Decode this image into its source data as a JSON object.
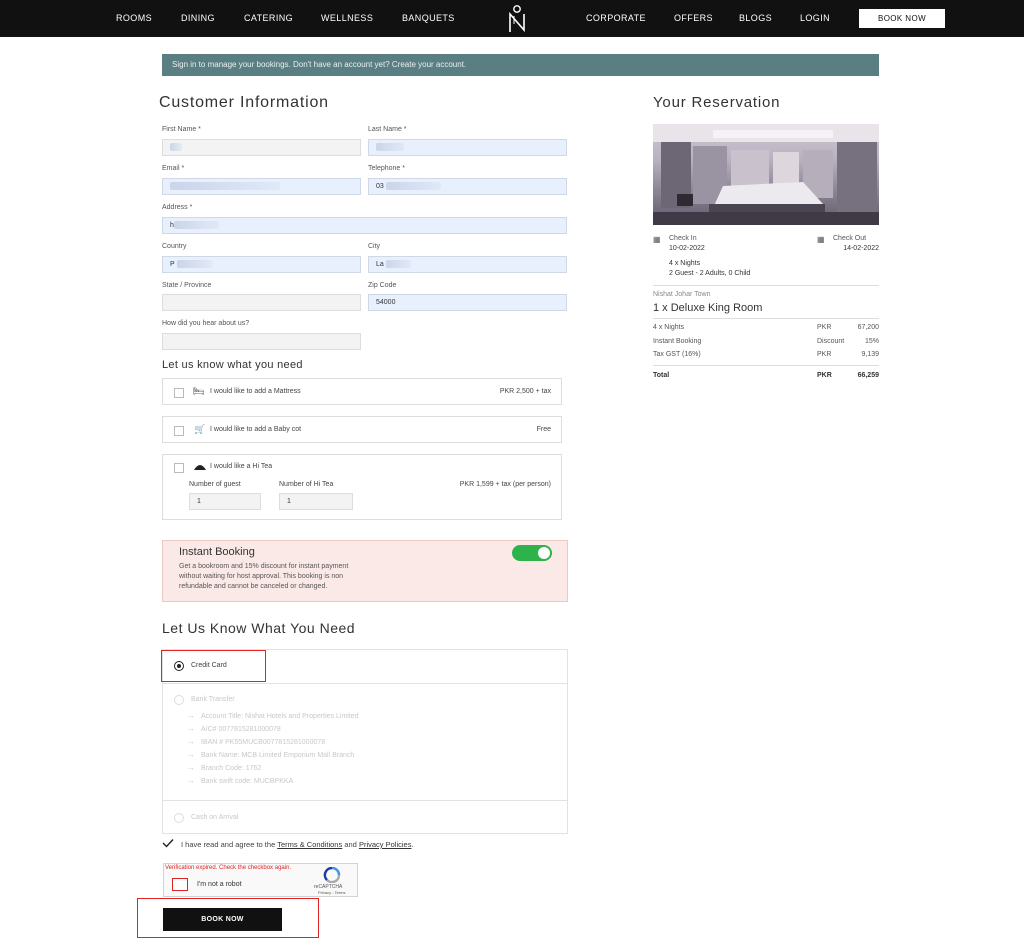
{
  "nav": {
    "left_items": [
      "ROOMS",
      "DINING",
      "CATERING",
      "WELLNESS",
      "BANQUETS"
    ],
    "right_items": [
      "CORPORATE",
      "OFFERS",
      "BLOGS",
      "LOGIN"
    ],
    "book_now": "BOOK NOW"
  },
  "notice": "Sign in to manage your bookings. Don't have an account yet? Create your account.",
  "customer": {
    "title": "Customer Information",
    "first_name_label": "First Name *",
    "last_name_label": "Last Name *",
    "email_label": "Email *",
    "telephone_label": "Telephone *",
    "telephone_value": "03",
    "address_label": "Address *",
    "address_value": "h",
    "country_label": "Country",
    "country_value": "P",
    "city_label": "City",
    "city_value": "La",
    "state_label": "State / Province",
    "zip_label": "Zip Code",
    "zip_value": "54000",
    "hear_label": "How did you hear about us?"
  },
  "extras": {
    "title": "Let us know what you need",
    "mattress_label": "I would like to add a Mattress",
    "mattress_price": "PKR 2,500 + tax",
    "babycot_label": "I would like to add a Baby cot",
    "babycot_price": "Free",
    "hitea_label": "I would like a Hi Tea",
    "guests_label": "Number of guest",
    "hitea_count_label": "Number of Hi Tea",
    "guests_value": "1",
    "hitea_value": "1",
    "hitea_price": "PKR 1,599 + tax (per person)"
  },
  "instant": {
    "title": "Instant Booking",
    "line1": "Get a bookroom and 15% discount for instant payment",
    "line2": "without waiting for host approval. This booking is non",
    "line3": "refundable and cannot be canceled or changed."
  },
  "payment": {
    "title": "Let Us Know What You Need",
    "credit_card": "Credit Card",
    "bank_transfer": "Bank Transfer",
    "bank_details": [
      "Account Title: Nishat Hotels and Properties Limited",
      "A/C# 0077815281000078",
      "IBAN # PK55MUCB0077815281000078",
      "Bank Name: MCB Limited Emporium Mall Branch",
      "Branch Code: 1762",
      "Bank swift code: MUCBPKKA"
    ],
    "cash": "Cash on Arrival"
  },
  "terms": {
    "prefix": "I have read and agree to the",
    "terms_link": "Terms & Conditions",
    "and": "and",
    "privacy_link": "Privacy Policies",
    "suffix": "."
  },
  "captcha": {
    "error": "Verification expired. Check the checkbox again.",
    "label": "I'm not a robot",
    "brand": "reCAPTCHA",
    "links": "Privacy - Terms"
  },
  "book_now_bottom": "BOOK NOW",
  "reservation": {
    "title": "Your Reservation",
    "checkin_label": "Check In",
    "checkin_date": "10-02-2022",
    "checkout_label": "Check Out",
    "checkout_date": "14-02-2022",
    "nights": "4 x Nights",
    "guests": "2 Guest - 2 Adults, 0 Child",
    "location": "Nishat Johar Town",
    "room": "1 x Deluxe King Room",
    "rows": [
      {
        "label": "4 x Nights",
        "unit": "PKR",
        "value": "67,200"
      },
      {
        "label": "Instant Booking",
        "unit": "Discount",
        "value": "15%"
      },
      {
        "label": "Tax GST (16%)",
        "unit": "PKR",
        "value": "9,139"
      }
    ],
    "total_label": "Total",
    "total_unit": "PKR",
    "total_value": "66,259"
  },
  "colors": {
    "notice_bg": "#5a7f83",
    "toggle_on": "#2db34a",
    "error_red": "#e02424"
  }
}
